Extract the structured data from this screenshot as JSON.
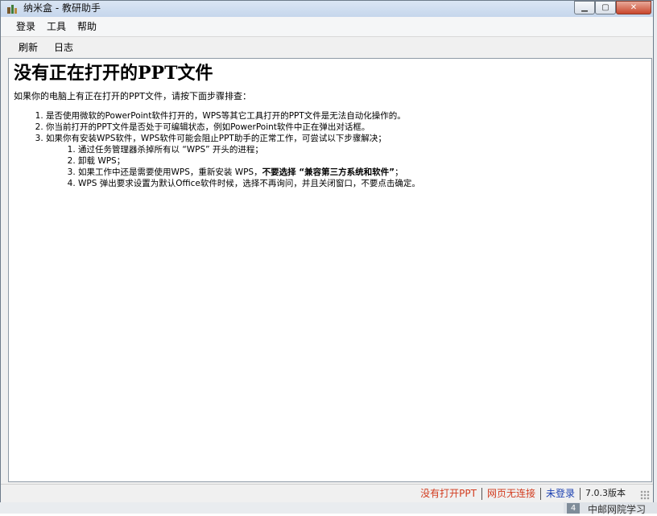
{
  "window": {
    "title": "纳米盒 - 教研助手"
  },
  "menu": [
    "登录",
    "工具",
    "帮助"
  ],
  "toolbar": [
    "刷新",
    "日志"
  ],
  "content": {
    "heading": "没有正在打开的PPT文件",
    "intro": "如果你的电脑上有正在打开的PPT文件，请按下面步骤排查：",
    "steps": [
      "是否使用微软的PowerPoint软件打开的，WPS等其它工具打开的PPT文件是无法自动化操作的。",
      "你当前打开的PPT文件是否处于可编辑状态，例如PowerPoint软件中正在弹出对话框。",
      "如果你有安装WPS软件，WPS软件可能会阻止PPT助手的正常工作，可尝试以下步骤解决；"
    ],
    "substeps": {
      "s1": "通过任务管理器杀掉所有以 “WPS” 开头的进程；",
      "s2": "卸载 WPS；",
      "s3_prefix": "如果工作中还是需要使用WPS，重新安装 WPS，",
      "s3_bold": "不要选择 “兼容第三方系统和软件”",
      "s3_suffix": "；",
      "s4": "WPS 弹出要求设置为默认Office软件时候，选择不再询问，并且关闭窗口，不要点击确定。"
    }
  },
  "status": {
    "ppt": "没有打开PPT",
    "web": "网页无连接",
    "login": "未登录",
    "version": "7.0.3版本"
  },
  "background": {
    "taskbar_badge": "4",
    "taskbar_text": "中邮网院学习"
  },
  "colors": {
    "status_red": "#d23b1e",
    "status_blue": "#1a3fb0",
    "titlebar": "#c5d6ec",
    "close_button": "#c9462c"
  }
}
